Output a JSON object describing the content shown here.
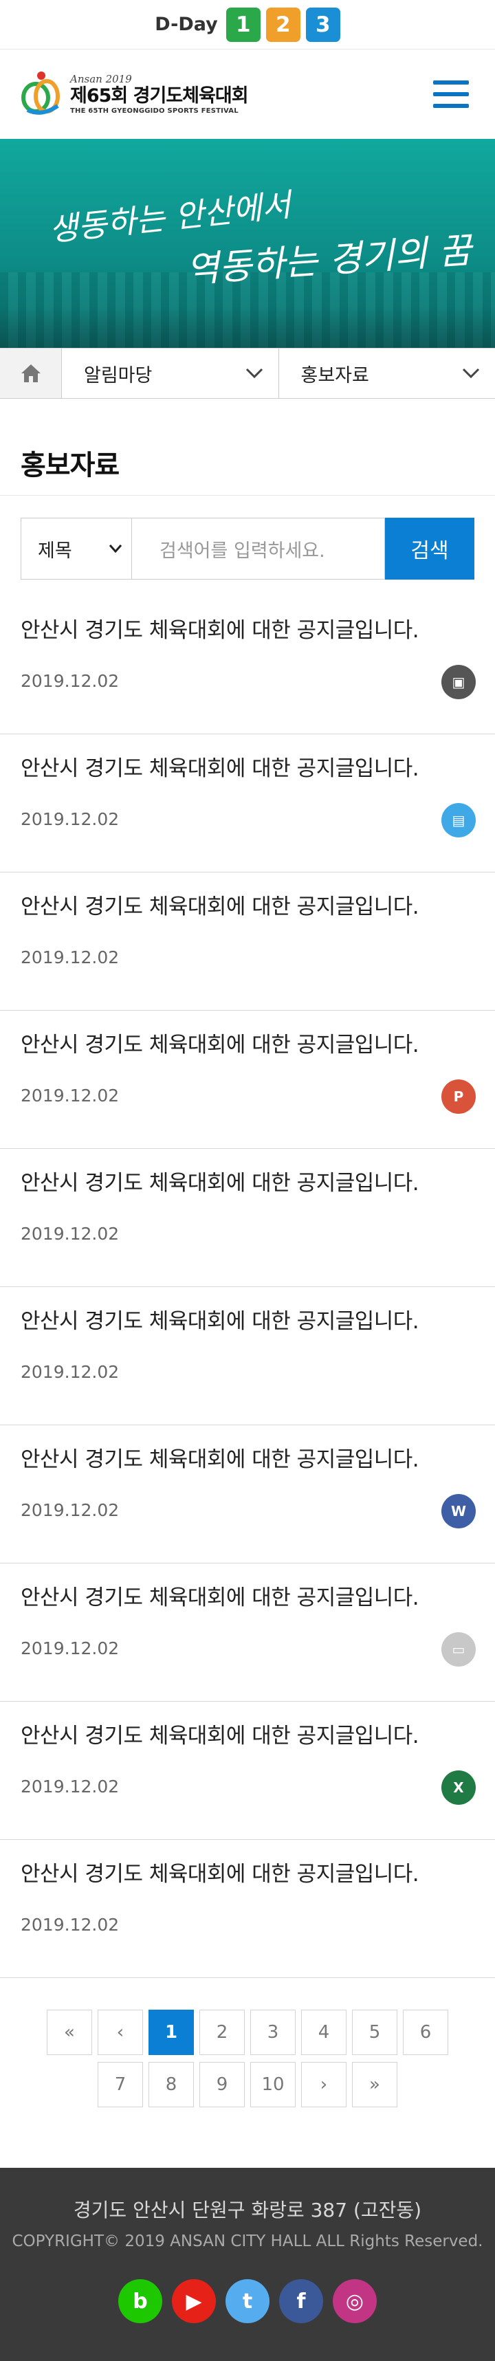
{
  "dday": {
    "label": "D-Day",
    "digits": [
      "1",
      "2",
      "3"
    ],
    "colors": [
      "#2aa84a",
      "#f0a02a",
      "#1a8fd6"
    ]
  },
  "header": {
    "logo_small": "Ansan 2019",
    "logo_big": "제65회 경기도체육대회",
    "logo_en": "THE 65TH GYEONGGIDO SPORTS FESTIVAL",
    "menu_icon": "hamburger-icon"
  },
  "banner": {
    "line1": "생동하는 안산에서",
    "line2": "역동하는 경기의 꿈"
  },
  "breadcrumb": {
    "home_icon": "home-icon",
    "level1": "알림마당",
    "level2": "홍보자료"
  },
  "page": {
    "title": "홍보자료"
  },
  "search": {
    "field_selected": "제목",
    "placeholder": "검색어를 입력하세요.",
    "button": "검색"
  },
  "posts": [
    {
      "title": "안산시 경기도 체육대회에 대한 공지글입니다.",
      "date": "2019.12.02",
      "icon": "save-file-icon"
    },
    {
      "title": "안산시 경기도 체육대회에 대한 공지글입니다.",
      "date": "2019.12.02",
      "icon": "image-file-icon"
    },
    {
      "title": "안산시 경기도 체육대회에 대한 공지글입니다.",
      "date": "2019.12.02",
      "icon": ""
    },
    {
      "title": "안산시 경기도 체육대회에 대한 공지글입니다.",
      "date": "2019.12.02",
      "icon": "ppt-file-icon"
    },
    {
      "title": "안산시 경기도 체육대회에 대한 공지글입니다.",
      "date": "2019.12.02",
      "icon": ""
    },
    {
      "title": "안산시 경기도 체육대회에 대한 공지글입니다.",
      "date": "2019.12.02",
      "icon": ""
    },
    {
      "title": "안산시 경기도 체육대회에 대한 공지글입니다.",
      "date": "2019.12.02",
      "icon": "word-file-icon"
    },
    {
      "title": "안산시 경기도 체육대회에 대한 공지글입니다.",
      "date": "2019.12.02",
      "icon": "pdf-file-icon"
    },
    {
      "title": "안산시 경기도 체육대회에 대한 공지글입니다.",
      "date": "2019.12.02",
      "icon": "excel-file-icon"
    },
    {
      "title": "안산시 경기도 체육대회에 대한 공지글입니다.",
      "date": "2019.12.02",
      "icon": ""
    }
  ],
  "pagination": {
    "first": "«",
    "prev": "‹",
    "next": "›",
    "last": "»",
    "current": "1",
    "pages": [
      "1",
      "2",
      "3",
      "4",
      "5",
      "6",
      "7",
      "8",
      "9",
      "10"
    ]
  },
  "footer": {
    "address": "경기도 안산시 단원구 화랑로 387 (고잔동)",
    "copyright": "COPYRIGHT© 2019 ANSAN CITY HALL ALL Rights Reserved.",
    "sns": [
      {
        "name": "blog-icon",
        "glyph": "b",
        "color": "#1ec800"
      },
      {
        "name": "youtube-icon",
        "glyph": "▶",
        "color": "#e62117"
      },
      {
        "name": "twitter-icon",
        "glyph": "t",
        "color": "#55acee"
      },
      {
        "name": "facebook-icon",
        "glyph": "f",
        "color": "#3b5998"
      },
      {
        "name": "instagram-icon",
        "glyph": "◎",
        "color": "#c13584"
      }
    ]
  }
}
